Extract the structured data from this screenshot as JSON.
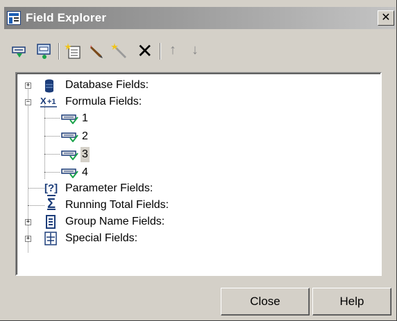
{
  "window": {
    "title": "Field Explorer",
    "close_glyph": "✕"
  },
  "toolbar": {
    "items": [
      {
        "icon": "insert-field-icon"
      },
      {
        "icon": "browse-field-icon"
      },
      {
        "icon": "new-field-icon"
      },
      {
        "icon": "edit-field-icon"
      },
      {
        "icon": "rename-field-icon"
      },
      {
        "icon": "delete-icon",
        "glyph": "✕"
      },
      {
        "icon": "move-up-icon",
        "glyph": "↑"
      },
      {
        "icon": "move-down-icon",
        "glyph": "↓"
      }
    ]
  },
  "tree": {
    "expanders": {
      "plus": "+",
      "minus": "−"
    },
    "nodes": [
      {
        "label": "Database Fields:",
        "icon": "database-icon",
        "state": "collapsed"
      },
      {
        "label": "Formula Fields:",
        "icon": "formula-icon",
        "state": "expanded",
        "children": [
          {
            "label": "1",
            "icon": "formula-field-icon"
          },
          {
            "label": "2",
            "icon": "formula-field-icon"
          },
          {
            "label": "3",
            "icon": "formula-field-icon",
            "selected": true
          },
          {
            "label": "4",
            "icon": "formula-field-icon"
          }
        ]
      },
      {
        "label": "Parameter Fields:",
        "icon": "parameter-icon",
        "icon_text": "[?]"
      },
      {
        "label": "Running Total Fields:",
        "icon": "sigma-icon",
        "icon_text": "Σ"
      },
      {
        "label": "Group Name Fields:",
        "icon": "group-icon",
        "state": "collapsed"
      },
      {
        "label": "Special Fields:",
        "icon": "special-fields-icon",
        "state": "collapsed"
      }
    ]
  },
  "buttons": {
    "close": "Close",
    "help": "Help"
  }
}
